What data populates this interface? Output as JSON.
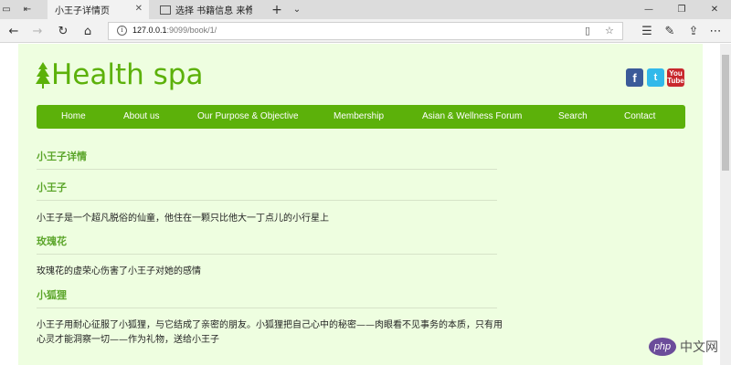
{
  "browser": {
    "tabs": [
      {
        "title": "小王子详情页",
        "active": true
      },
      {
        "title": "选择 书籍信息 来修改 | Djan",
        "active": false
      }
    ],
    "new_tab_icon": "plus-icon",
    "url": {
      "host": "127.0.0.1",
      "rest": ":9099/book/1/"
    }
  },
  "site": {
    "logo_text": "Health spa",
    "logo_icon": "tree-icon",
    "brand_color": "#5cb10a",
    "social": [
      {
        "name": "facebook",
        "label": "f",
        "color": "#3b5a99"
      },
      {
        "name": "twitter",
        "label": "t",
        "color": "#32b9ea"
      },
      {
        "name": "youtube",
        "label_top": "You",
        "label_bottom": "Tube",
        "color": "#c8282d"
      }
    ],
    "menu": [
      "Home",
      "About us",
      "Our Purpose & Objective",
      "Membership",
      "Asian & Wellness Forum",
      "Search",
      "Contact"
    ]
  },
  "book": {
    "page_heading": "小王子详情",
    "title": "小王子",
    "description": "小王子是一个超凡脱俗的仙童，他住在一颗只比他大一丁点儿的小行星上",
    "sections": [
      {
        "heading": "玫瑰花",
        "text": "玫瑰花的虚荣心伤害了小王子对她的感情"
      },
      {
        "heading": "小狐狸",
        "text": "小王子用耐心征服了小狐狸，与它结成了亲密的朋友。小狐狸把自己心中的秘密——肉眼看不见事务的本质，只有用心灵才能洞察一切——作为礼物，送给小王子"
      }
    ]
  },
  "watermark": {
    "logo": "php",
    "text": "中文网"
  }
}
